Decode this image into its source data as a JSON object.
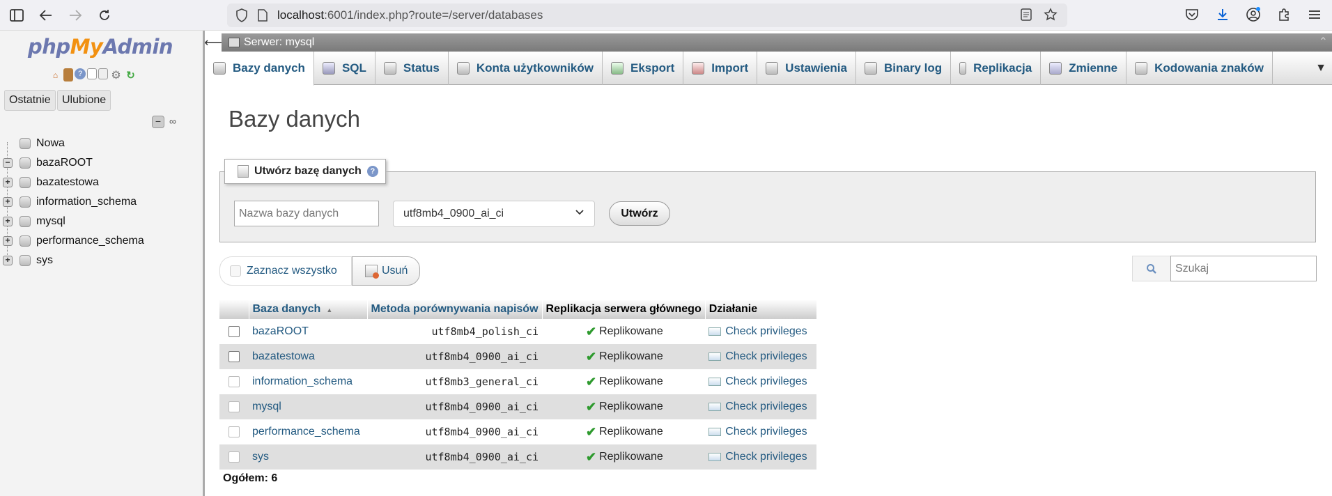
{
  "browser": {
    "url_host": "localhost",
    "url_rest": ":6001/index.php?route=/server/databases"
  },
  "sidebar": {
    "logo_php": "php",
    "logo_my": "My",
    "logo_admin": "Admin",
    "recent_label": "Ostatnie",
    "favorites_label": "Ulubione",
    "tree": [
      {
        "label": "Nowa",
        "expander": ""
      },
      {
        "label": "bazaROOT",
        "expander": "−"
      },
      {
        "label": "bazatestowa",
        "expander": "+"
      },
      {
        "label": "information_schema",
        "expander": "+"
      },
      {
        "label": "mysql",
        "expander": "+"
      },
      {
        "label": "performance_schema",
        "expander": "+"
      },
      {
        "label": "sys",
        "expander": "+"
      }
    ]
  },
  "server_bar": {
    "label": "Serwer: mysql"
  },
  "tabs": [
    {
      "label": "Bazy danych",
      "icon": "database-icon"
    },
    {
      "label": "SQL",
      "icon": "sql-icon"
    },
    {
      "label": "Status",
      "icon": "status-icon"
    },
    {
      "label": "Konta użytkowników",
      "icon": "users-icon"
    },
    {
      "label": "Eksport",
      "icon": "export-icon"
    },
    {
      "label": "Import",
      "icon": "import-icon"
    },
    {
      "label": "Ustawienia",
      "icon": "wrench-icon"
    },
    {
      "label": "Binary log",
      "icon": "binlog-icon"
    },
    {
      "label": "Replikacja",
      "icon": "replication-icon"
    },
    {
      "label": "Zmienne",
      "icon": "variables-icon"
    },
    {
      "label": "Kodowania znaków",
      "icon": "charset-icon"
    }
  ],
  "main": {
    "title": "Bazy danych",
    "create": {
      "legend": "Utwórz bazę danych",
      "name_placeholder": "Nazwa bazy danych",
      "collation_value": "utf8mb4_0900_ai_ci",
      "button": "Utwórz"
    },
    "select_all": "Zaznacz wszystko",
    "delete": "Usuń",
    "search_placeholder": "Szukaj",
    "table": {
      "headers": [
        "Baza danych",
        "Metoda porównywania napisów",
        "Replikacja serwera głównego",
        "Działanie"
      ],
      "rows": [
        {
          "name": "bazaROOT",
          "collation": "utf8mb4_polish_ci",
          "replication": "Replikowane",
          "action": "Check privileges"
        },
        {
          "name": "bazatestowa",
          "collation": "utf8mb4_0900_ai_ci",
          "replication": "Replikowane",
          "action": "Check privileges"
        },
        {
          "name": "information_schema",
          "collation": "utf8mb3_general_ci",
          "replication": "Replikowane",
          "action": "Check privileges"
        },
        {
          "name": "mysql",
          "collation": "utf8mb4_0900_ai_ci",
          "replication": "Replikowane",
          "action": "Check privileges"
        },
        {
          "name": "performance_schema",
          "collation": "utf8mb4_0900_ai_ci",
          "replication": "Replikowane",
          "action": "Check privileges"
        },
        {
          "name": "sys",
          "collation": "utf8mb4_0900_ai_ci",
          "replication": "Replikowane",
          "action": "Check privileges"
        }
      ]
    },
    "total": "Ogółem: 6"
  }
}
